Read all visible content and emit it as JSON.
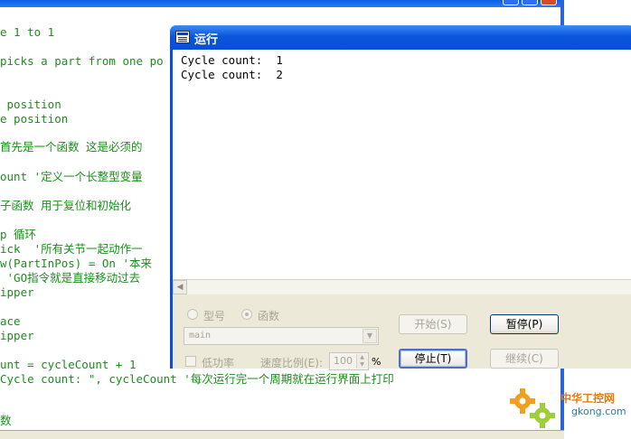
{
  "code_lines": [
    {
      "text": "e 1 to 1",
      "color": "#1a8f1a"
    },
    {
      "text": "picks a part from one po",
      "color": "#1a8f1a"
    },
    {
      "text": " position",
      "color": "#1a8f1a"
    },
    {
      "text": "e position",
      "color": "#1a8f1a"
    },
    {
      "text": "首先是一个函数 这是必须的",
      "color": "#1a8f1a"
    },
    {
      "text": "ount '定义一个长整型变量",
      "color": "#1a8f1a"
    },
    {
      "text": "子函数 用于复位和初始化",
      "color": "#1a8f1a"
    },
    {
      "text": "p 循环",
      "color": "#1a8f1a"
    },
    {
      "text": "ick  '所有关节一起动作一",
      "color": "#1a8f1a"
    },
    {
      "text": "w(PartInPos) = On '本来",
      "color": "#1a8f1a"
    },
    {
      "text": " 'GO指令就是直接移动过去",
      "color": "#1a8f1a"
    },
    {
      "text": "ipper",
      "color": "#1a8f1a"
    },
    {
      "text": "ace",
      "color": "#1a8f1a"
    },
    {
      "text": "ipper",
      "color": "#1a8f1a"
    },
    {
      "text": "unt = cycleCount + 1",
      "color": "#1a8f1a"
    },
    {
      "text": "Cycle count: \", cycleCount '每次运行完一个周期就在运行界面上打印",
      "color": "#1a8f1a"
    },
    {
      "text": "数",
      "color": "#1a8f1a"
    }
  ],
  "dialog": {
    "title": "运行",
    "output_lines": [
      "Cycle count:  1",
      "Cycle count:  2"
    ],
    "radio_type_label": "型号",
    "radio_function_label": "函数",
    "function_select_value": "main",
    "low_power_label": "低功率",
    "speed_ratio_label": "速度比例(E):",
    "speed_value": "100",
    "speed_unit": "%",
    "buttons": {
      "start": "开始(S)",
      "pause": "暂停(P)",
      "stop": "停止(T)",
      "continue": "继续(C)"
    }
  },
  "watermark": {
    "text": "中华工控网",
    "url": "gkong.com"
  },
  "colors": {
    "xp_blue": "#0a4fd8",
    "code_green": "#1a8f1a",
    "watermark_orange": "#e87a10"
  }
}
